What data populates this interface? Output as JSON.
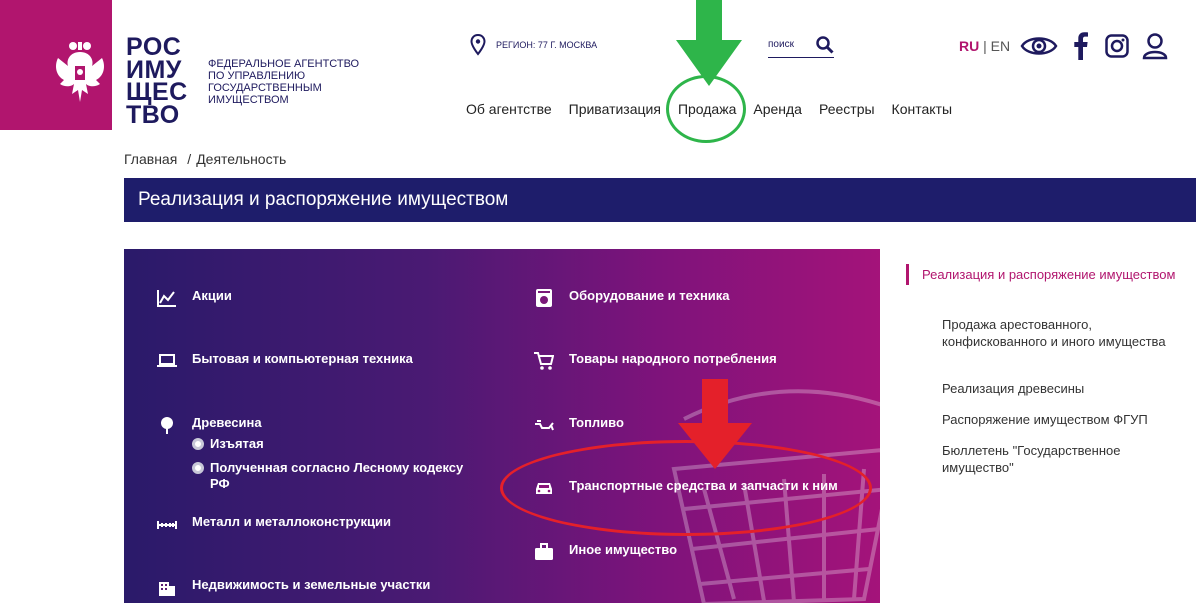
{
  "header": {
    "logo_lines": [
      "РОС",
      "ИМУ",
      "ЩЕС",
      "ТВО"
    ],
    "logo_subtitle": "Федеральное агентство по управлению государственным имуществом",
    "region": "РЕГИОН: 77 Г. МОСКВА",
    "search_placeholder": "поиск",
    "lang_active": "RU",
    "lang_sep": " | ",
    "lang_other": "EN"
  },
  "nav": {
    "items": [
      "Об агентстве",
      "Приватизация",
      "Продажа",
      "Аренда",
      "Реестры",
      "Контакты"
    ]
  },
  "breadcrumb": {
    "home": "Главная",
    "sep": "/",
    "current": "Деятельность"
  },
  "banner": {
    "title": "Реализация и распоряжение имуществом"
  },
  "categories": {
    "left": [
      {
        "label": "Акции",
        "icon": "chart-icon"
      },
      {
        "label": "Бытовая и компьютерная техника",
        "icon": "laptop-icon"
      },
      {
        "label": "Древесина",
        "icon": "tree-icon"
      },
      {
        "label": "Металл и металлоконструкции",
        "icon": "metal-icon"
      },
      {
        "label": "Недвижимость и земельные участки",
        "icon": "building-icon"
      }
    ],
    "wood_sub": [
      "Изъятая",
      "Полученная согласно Лесному кодексу РФ"
    ],
    "right": [
      {
        "label": "Оборудование и техника",
        "icon": "equipment-icon"
      },
      {
        "label": "Товары народного потребления",
        "icon": "cart-icon"
      },
      {
        "label": "Топливо",
        "icon": "fuel-icon"
      },
      {
        "label": "Транспортные средства и запчасти к ним",
        "icon": "car-icon"
      },
      {
        "label": "Иное имущество",
        "icon": "briefcase-icon"
      }
    ]
  },
  "side_menu": {
    "active": "Реализация и распоряжение имуществом",
    "items": [
      "Продажа арестованного, конфискованного и иного имущества",
      "Реализация древесины",
      "Распоряжение имуществом ФГУП",
      "Бюллетень \"Государственное имущество\""
    ]
  },
  "colors": {
    "brand_magenta": "#b1156e",
    "brand_navy": "#1e1d6b",
    "annotation_green": "#2eb54a",
    "annotation_red": "#e4202a"
  }
}
